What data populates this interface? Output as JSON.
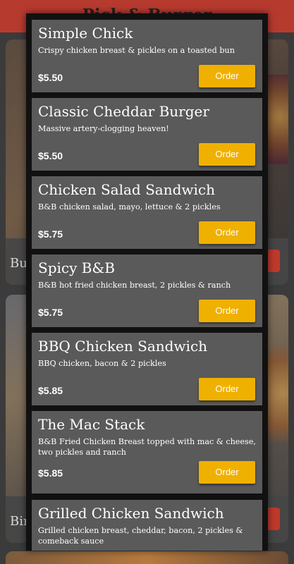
{
  "background": {
    "title": "Pick & Burger",
    "cards": [
      {
        "label": "Bu"
      },
      {
        "label": "Bir"
      }
    ]
  },
  "menu": {
    "accent_color": "#f0b000",
    "item_bg": "#5a5a5a",
    "items": [
      {
        "name": "Simple Chick",
        "description": "Crispy chicken breast & pickles on a toasted bun",
        "price": "$5.50",
        "button": "Order"
      },
      {
        "name": "Classic Cheddar Burger",
        "description": "Massive artery-clogging heaven!",
        "price": "$5.50",
        "button": "Order"
      },
      {
        "name": "Chicken Salad Sandwich",
        "description": "B&B chicken salad, mayo, lettuce & 2 pickles",
        "price": "$5.75",
        "button": "Order"
      },
      {
        "name": "Spicy B&B",
        "description": "B&B hot fried chicken breast, 2 pickles & ranch",
        "price": "$5.75",
        "button": "Order"
      },
      {
        "name": "BBQ Chicken Sandwich",
        "description": "BBQ chicken, bacon & 2 pickles",
        "price": "$5.85",
        "button": "Order"
      },
      {
        "name": "The Mac Stack",
        "description": "B&B Fried Chicken Breast topped with mac & cheese, two pickles and ranch",
        "price": "$5.85",
        "button": "Order"
      },
      {
        "name": "Grilled Chicken Sandwich",
        "description": "Grilled chicken breast, cheddar, bacon, 2 pickles & comeback sauce",
        "price": "",
        "button": ""
      }
    ]
  }
}
